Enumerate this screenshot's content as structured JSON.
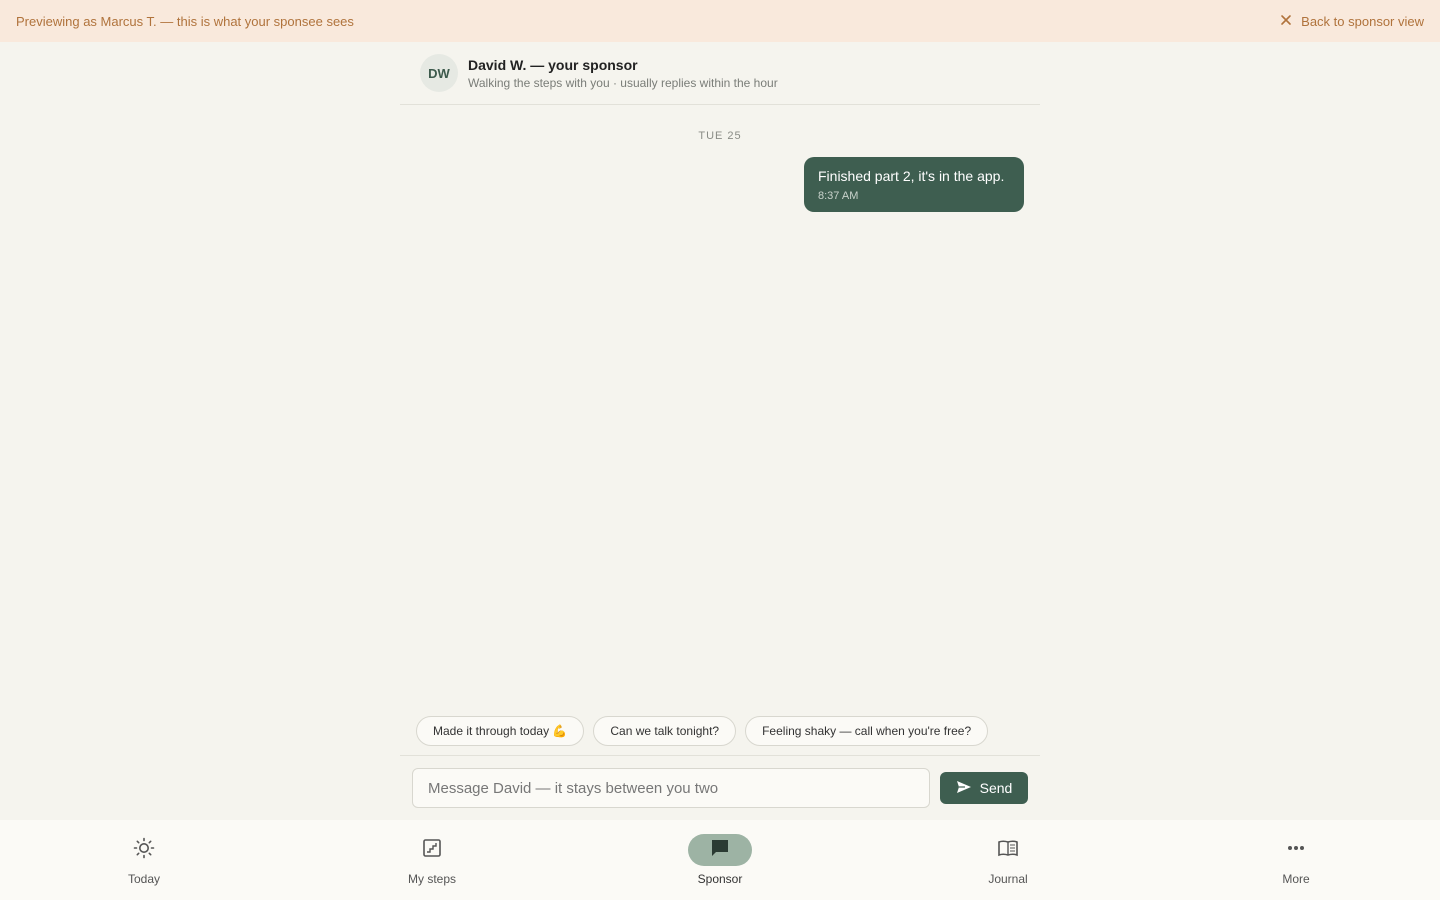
{
  "banner": {
    "preview_text": "Previewing as Marcus T. — this is what your sponsee sees",
    "back_label": "Back to sponsor view",
    "color": "#b0733c",
    "background": "#f9e9dc"
  },
  "chat_header": {
    "avatar_initials": "DW",
    "name": "David W. — your sponsor",
    "subtitle": "Walking the steps with you · usually replies within the hour"
  },
  "messages": {
    "date_label": "TUE 25",
    "items": [
      {
        "text": "Finished part 2, it's in the app.",
        "time": "8:37 AM",
        "from": "me"
      }
    ]
  },
  "quick_replies": [
    "Made it through today 💪",
    "Can we talk tonight?",
    "Feeling shaky — call when you're free?"
  ],
  "composer": {
    "placeholder": "Message David — it stays between you two",
    "send_label": "Send"
  },
  "bottom_nav": {
    "items": [
      {
        "label": "Today",
        "icon": "sun-icon",
        "active": false
      },
      {
        "label": "My steps",
        "icon": "stairs-icon",
        "active": false
      },
      {
        "label": "Sponsor",
        "icon": "chat-icon",
        "active": true
      },
      {
        "label": "Journal",
        "icon": "book-icon",
        "active": false
      },
      {
        "label": "More",
        "icon": "more-icon",
        "active": false
      }
    ]
  },
  "colors": {
    "accent": "#3e5e50",
    "accent_light": "#9db3a4",
    "background": "#f5f4ee"
  }
}
